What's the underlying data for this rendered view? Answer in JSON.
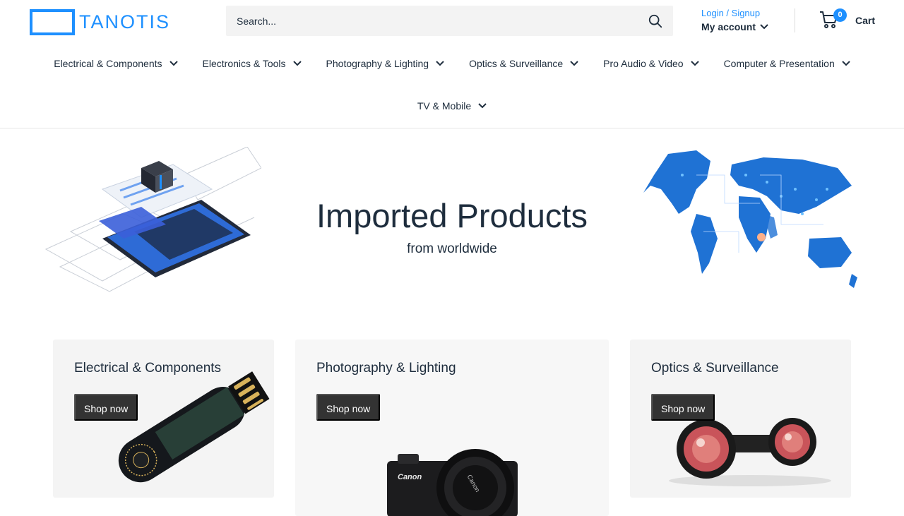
{
  "brand": {
    "name": "TANOTIS",
    "color": "#1e90ff"
  },
  "search": {
    "placeholder": "Search...",
    "icon": "search-icon"
  },
  "account": {
    "login_label": "Login / Signup",
    "my_account_label": "My account"
  },
  "cart": {
    "count": "0",
    "label": "Cart"
  },
  "nav": {
    "items": [
      {
        "label": "Electrical & Components"
      },
      {
        "label": "Electronics & Tools"
      },
      {
        "label": "Photography & Lighting"
      },
      {
        "label": "Optics & Surveillance"
      },
      {
        "label": "Pro Audio & Video"
      },
      {
        "label": "Computer & Presentation"
      },
      {
        "label": "TV & Mobile"
      }
    ]
  },
  "hero": {
    "title": "Imported Products",
    "subtitle": "from worldwide"
  },
  "collections": [
    {
      "title": "Electrical & Components",
      "button": "Shop now"
    },
    {
      "title": "Photography & Lighting",
      "button": "Shop now"
    },
    {
      "title": "Optics & Surveillance",
      "button": "Shop now"
    }
  ],
  "colors": {
    "accent": "#1e90ff",
    "text": "#1e2d3d",
    "button_bg": "#333333"
  }
}
